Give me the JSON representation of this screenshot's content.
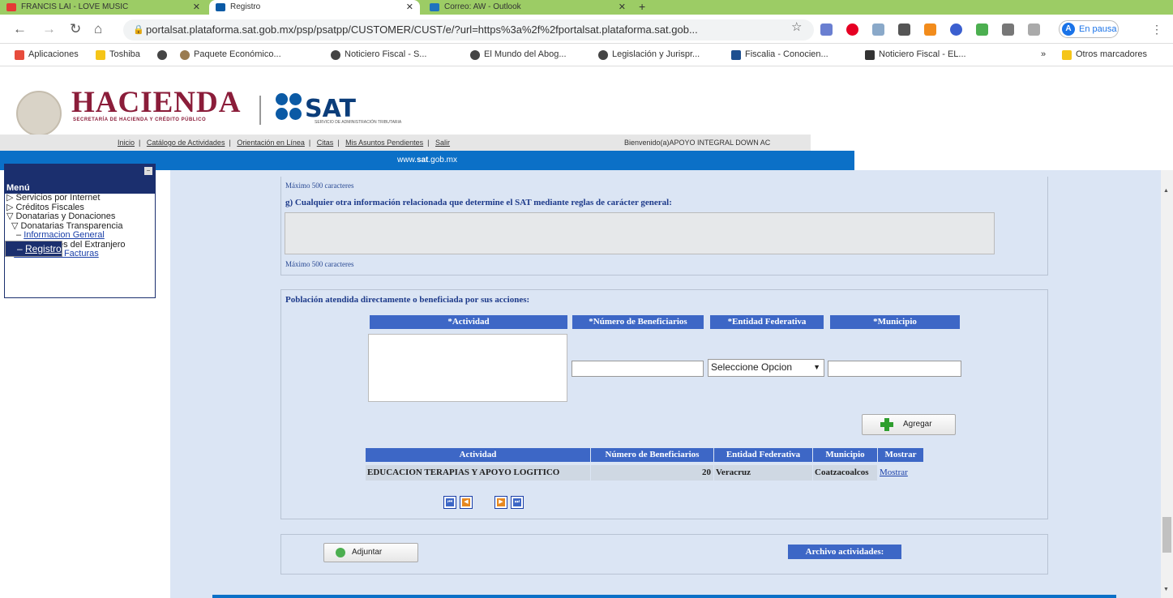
{
  "browser": {
    "tabs": [
      {
        "title": "FRANCIS LAI - LOVE MUSIC",
        "active": false
      },
      {
        "title": "Registro",
        "active": true
      },
      {
        "title": "Correo: AW - Outlook",
        "active": false
      }
    ],
    "url": "portalsat.plataforma.sat.gob.mx/psp/psatpp/CUSTOMER/CUST/e/?url=https%3a%2f%2fportalsat.plataforma.sat.gob...",
    "profile_status": "En pausa",
    "profile_initial": "A",
    "bookmarks": [
      "Aplicaciones",
      "Toshiba",
      "",
      "Paquete Económico...",
      "Noticiero Fiscal - S...",
      "El Mundo del Abog...",
      "Legislación y Jurispr...",
      "Fiscalia - Conocien...",
      "Noticiero Fiscal - EL..."
    ],
    "other_bookmarks": "Otros marcadores",
    "overflow": "»"
  },
  "header": {
    "hacienda": "HACIENDA",
    "hacienda_sub": "SECRETARÍA DE HACIENDA Y CRÉDITO PÚBLICO",
    "sat": "SAT",
    "sat_sub": "SERVICIO DE ADMINISTRACIÓN TRIBUTARIA",
    "links": [
      "Inicio",
      "Catálogo de Actividades",
      "Orientación en Línea",
      "Citas",
      "Mis Asuntos Pendientes",
      "Salir"
    ],
    "welcome": "Bienvenido(a)APOYO INTEGRAL DOWN AC",
    "site_pre": "www.",
    "site_bold": "sat",
    "site_post": ".gob.mx"
  },
  "menu": {
    "title": "Menú",
    "items": [
      {
        "label": "Servicios por Internet",
        "prefix": "▷ "
      },
      {
        "label": "Créditos Fiscales",
        "prefix": "▷ "
      },
      {
        "label": "Donatarias y Donaciones",
        "prefix": "▽ "
      },
      {
        "label": "Donatarias Transparencia",
        "prefix": "▽ "
      },
      {
        "label": "Informacion General",
        "prefix": "– "
      },
      {
        "label": "Registro",
        "prefix": "– "
      },
      {
        "label": "Donaciones del Extranjero",
        "prefix": "▷ "
      },
      {
        "label": "Consulta de Facturas",
        "prefix": "– "
      }
    ]
  },
  "form": {
    "max_chars_1": "Máximo 500 caracteres",
    "question_g": "g) Cualquier otra información relacionada que determine el SAT mediante reglas de carácter general:",
    "max_chars_2": "Máximo 500 caracteres",
    "population_title": "Población atendida directamente o beneficiada por sus acciones:",
    "col_actividad": "*Actividad",
    "col_beneficiarios": "*Número de Beneficiarios",
    "col_entidad": "*Entidad Federativa",
    "col_municipio": "*Municipio",
    "select_value": "Seleccione Opcion",
    "add_button": "Agregar",
    "table": {
      "headers": [
        "Actividad",
        "Número de Beneficiarios",
        "Entidad Federativa",
        "Municipio",
        "Mostrar"
      ],
      "rows": [
        {
          "actividad": "EDUCACION TERAPIAS Y APOYO LOGITICO",
          "beneficiarios": "20",
          "entidad": "Veracruz",
          "municipio": "Coatzacoalcos",
          "mostrar": "Mostrar"
        }
      ]
    },
    "attach_button": "Adjuntar",
    "archivo_label": "Archivo actividades:"
  },
  "colors": {
    "accent_blue": "#3d67c6",
    "hacienda": "#8b1d3a",
    "sat_blue": "#0b70c7"
  }
}
